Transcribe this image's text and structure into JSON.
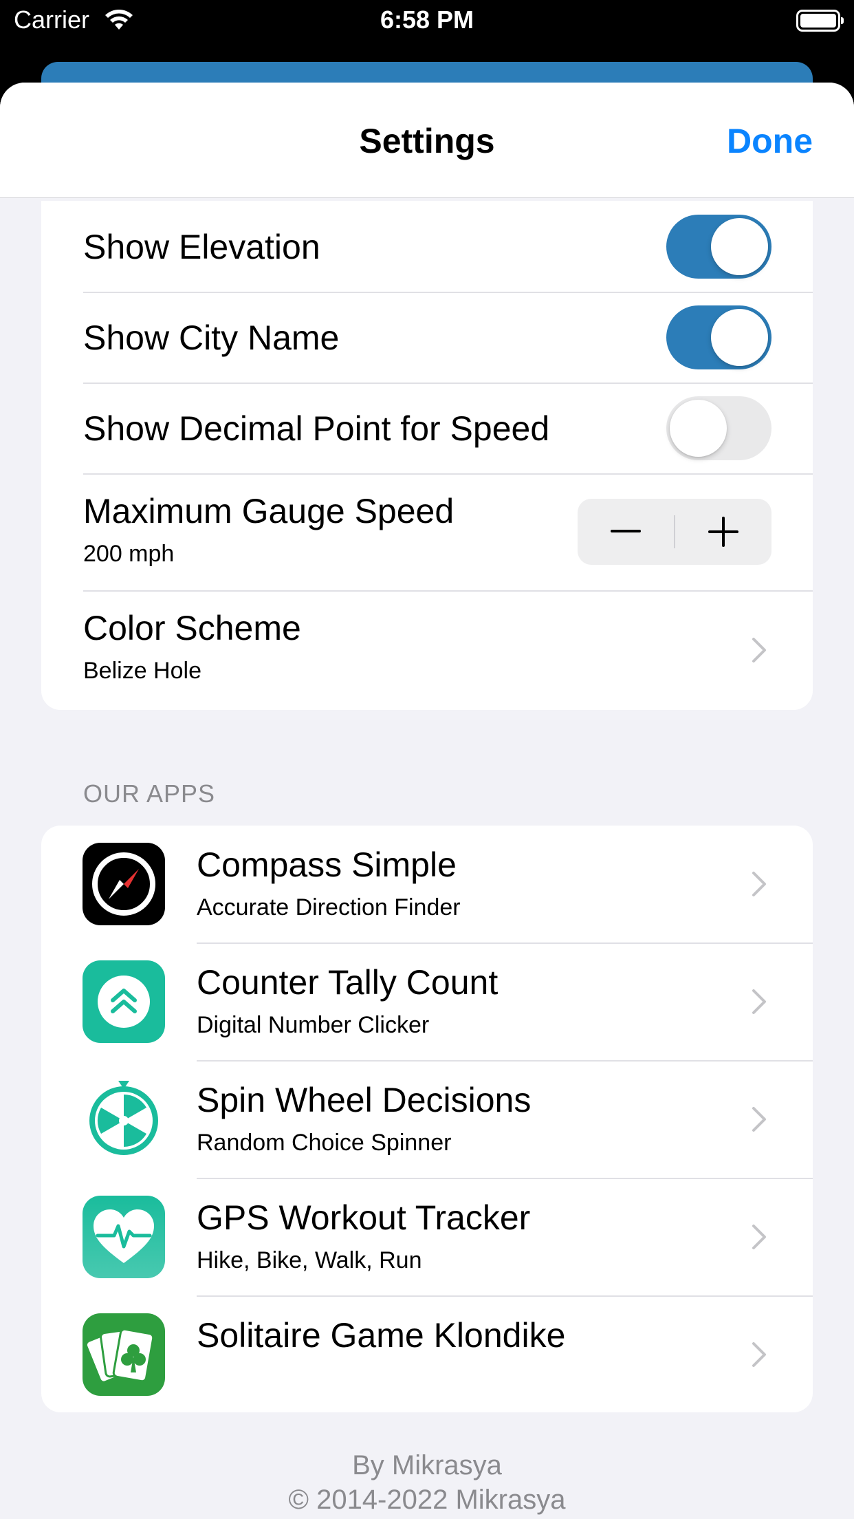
{
  "status_bar": {
    "carrier": "Carrier",
    "time": "6:58 PM"
  },
  "nav": {
    "title": "Settings",
    "done_label": "Done"
  },
  "settings": {
    "show_elevation": {
      "label": "Show Elevation",
      "on": true
    },
    "show_city_name": {
      "label": "Show City Name",
      "on": true
    },
    "show_decimal_point": {
      "label": "Show Decimal Point for Speed",
      "on": false
    },
    "max_gauge_speed": {
      "label": "Maximum Gauge Speed",
      "value": "200 mph"
    },
    "color_scheme": {
      "label": "Color Scheme",
      "value": "Belize Hole"
    }
  },
  "apps_section": {
    "header": "OUR APPS",
    "items": [
      {
        "title": "Compass Simple",
        "subtitle": "Accurate Direction Finder",
        "icon": "compass-icon"
      },
      {
        "title": "Counter Tally Count",
        "subtitle": "Digital Number Clicker",
        "icon": "counter-icon"
      },
      {
        "title": "Spin Wheel Decisions",
        "subtitle": "Random Choice Spinner",
        "icon": "spin-wheel-icon"
      },
      {
        "title": "GPS Workout Tracker",
        "subtitle": "Hike, Bike, Walk, Run",
        "icon": "heart-pulse-icon"
      },
      {
        "title": "Solitaire Game Klondike",
        "subtitle": "",
        "icon": "playing-cards-icon"
      }
    ]
  },
  "footer": {
    "by": "By Mikrasya",
    "copyright": "© 2014-2022 Mikrasya"
  },
  "colors": {
    "accent": "#2c7db8",
    "link": "#0a84ff",
    "teal": "#1abc9c",
    "green": "#2e9e3f"
  }
}
